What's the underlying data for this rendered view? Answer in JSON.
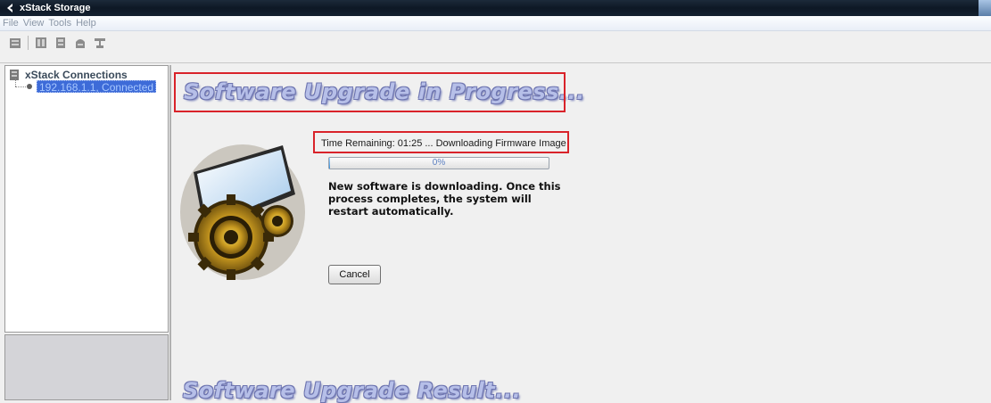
{
  "window": {
    "title": "xStack Storage"
  },
  "menu": {
    "items": [
      "File",
      "View",
      "Tools",
      "Help"
    ]
  },
  "toolbar": {
    "buttons": [
      "server-icon",
      "device-icon",
      "drive-icon",
      "storage-icon",
      "network-icon"
    ]
  },
  "tree": {
    "root_label": "xStack Connections",
    "items": [
      {
        "label": "192.168.1.1, Connected",
        "selected": true
      }
    ]
  },
  "upgrade": {
    "heading": "Software Upgrade in Progress...",
    "time_remaining": "Time Remaining: 01:25 ... Downloading Firmware Image",
    "progress_percent": 0,
    "progress_label": "0%",
    "message": "New software is downloading. Once this process completes, the system will restart automatically.",
    "cancel_label": "Cancel"
  },
  "result": {
    "heading": "Software Upgrade Result..."
  },
  "colors": {
    "highlight_box": "#d9232a",
    "heading_fill": "#b6bfe8",
    "selection": "#3d6bd8"
  }
}
